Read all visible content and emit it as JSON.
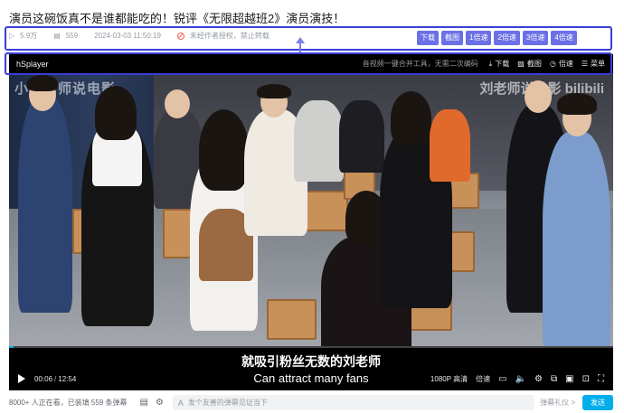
{
  "video": {
    "title": "演员这碗饭真不是谁都能吃的！锐评《无限超越班2》演员演技！",
    "views": "5.9万",
    "danmaku_count": "559",
    "published": "2024-03-03 11:50:19",
    "copyright_notice": "未经作者授权，禁止转载"
  },
  "quick_buttons": [
    "下载",
    "截图",
    "1倍速",
    "2倍速",
    "3倍速",
    "4倍速"
  ],
  "player": {
    "brand": "hSplayer",
    "toolbar_tip": "音视频一键合并工具，无需二次编码",
    "toolbar": {
      "download": "下载",
      "screenshot": "截图",
      "speed": "倍速",
      "menu": "菜单"
    },
    "watermark_left": "小刘老师说电影",
    "watermark_right": "刘老师说电影 bilibili",
    "subtitle_cn": "就吸引粉丝无数的刘老师",
    "subtitle_en": "Can attract many fans",
    "current_time": "00:06",
    "duration": "12:54",
    "progress": 0.008,
    "quality": "1080P 高清",
    "speed_label": "倍速"
  },
  "bottom_bar": {
    "viewers": "8000+ 人正在看，已装填 559 条弹幕",
    "danmaku_placeholder": "发个友善的弹幕见证当下",
    "etiquette": "弹幕礼仪 >",
    "send": "发送"
  },
  "colors": {
    "accent_blue": "#00aeec",
    "quick_btn": "#6b70e6",
    "highlight_border": "#3a3fd6"
  }
}
